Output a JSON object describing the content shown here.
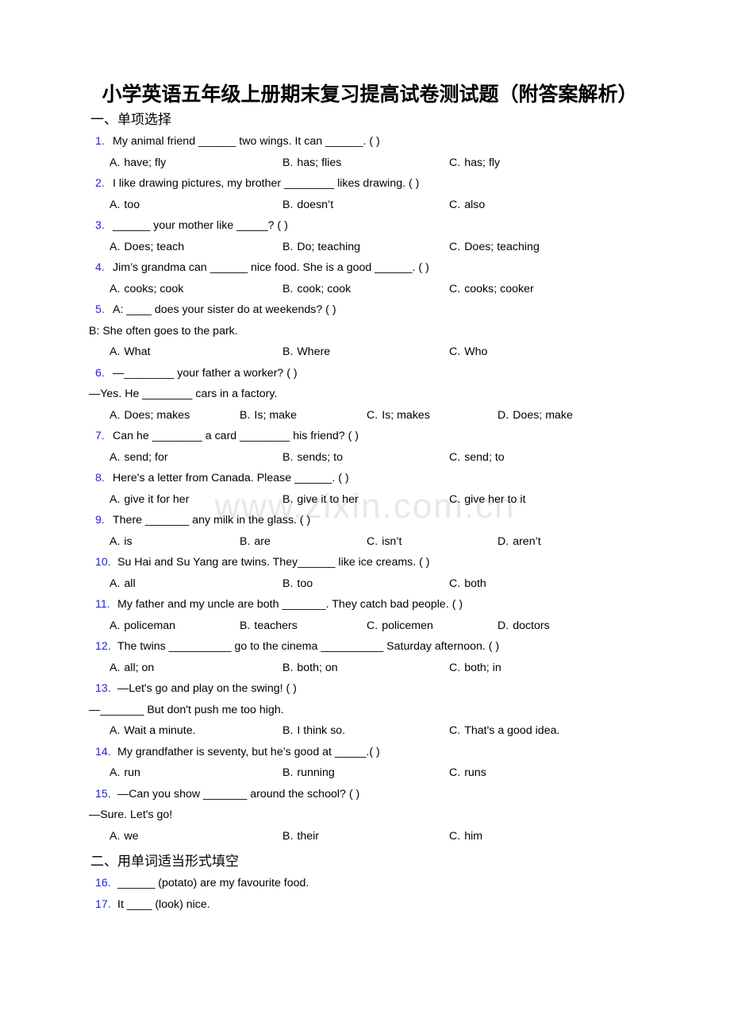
{
  "document": {
    "title": "小学英语五年级上册期末复习提高试卷测试题（附答案解析）",
    "watermark": "www.zixin.com.cn"
  },
  "sections": [
    {
      "heading": "一、单项选择",
      "questions": [
        {
          "num": "1.",
          "stem": "My animal friend ______ two wings. It can ______. (  )",
          "extra": null,
          "options": [
            {
              "label": "A.",
              "text": "have; fly"
            },
            {
              "label": "B.",
              "text": "has; flies"
            },
            {
              "label": "C.",
              "text": "has; fly"
            }
          ]
        },
        {
          "num": "2.",
          "stem": "I like drawing pictures, my brother ________ likes drawing. (    )",
          "extra": null,
          "options": [
            {
              "label": "A.",
              "text": "too"
            },
            {
              "label": "B.",
              "text": "doesn’t"
            },
            {
              "label": "C.",
              "text": "also"
            }
          ]
        },
        {
          "num": "3.",
          "stem": "______ your mother like _____? (  )",
          "extra": null,
          "options": [
            {
              "label": "A.",
              "text": "Does; teach"
            },
            {
              "label": "B.",
              "text": "Do; teaching"
            },
            {
              "label": "C.",
              "text": "Does; teaching"
            }
          ]
        },
        {
          "num": "4.",
          "stem": "Jim’s grandma can ______ nice food. She is a good ______. (  )",
          "extra": null,
          "options": [
            {
              "label": "A.",
              "text": "cooks; cook"
            },
            {
              "label": "B.",
              "text": "cook; cook"
            },
            {
              "label": "C.",
              "text": "cooks; cooker"
            }
          ]
        },
        {
          "num": "5.",
          "stem": "A: ____ does your sister do at weekends? (  )",
          "extra": "B: She often goes to the park.",
          "options": [
            {
              "label": "A.",
              "text": "What"
            },
            {
              "label": "B.",
              "text": "Where"
            },
            {
              "label": "C.",
              "text": "Who"
            }
          ]
        },
        {
          "num": "6.",
          "stem": "—________ your father a worker? (   )",
          "extra": "—Yes. He ________ cars in a factory.",
          "options": [
            {
              "label": "A.",
              "text": "Does; makes"
            },
            {
              "label": "B.",
              "text": "Is; make"
            },
            {
              "label": "C.",
              "text": "Is; makes"
            },
            {
              "label": "D.",
              "text": "Does; make"
            }
          ]
        },
        {
          "num": "7.",
          "stem": "Can he ________ a card ________ his friend? (   )",
          "extra": null,
          "options": [
            {
              "label": "A.",
              "text": "send; for"
            },
            {
              "label": "B.",
              "text": "sends; to"
            },
            {
              "label": "C.",
              "text": "send; to"
            }
          ]
        },
        {
          "num": "8.",
          "stem": "Here's a letter from Canada. Please ______. (  )",
          "extra": null,
          "options": [
            {
              "label": "A.",
              "text": "give it for her"
            },
            {
              "label": "B.",
              "text": "give it to her"
            },
            {
              "label": "C.",
              "text": "give her to it"
            }
          ]
        },
        {
          "num": "9.",
          "stem": "There _______ any milk in the glass. (  )",
          "extra": null,
          "options": [
            {
              "label": "A.",
              "text": "is"
            },
            {
              "label": "B.",
              "text": "are"
            },
            {
              "label": "C.",
              "text": "isn’t"
            },
            {
              "label": "D.",
              "text": "aren’t"
            }
          ]
        },
        {
          "num": "10.",
          "stem": "Su Hai and Su Yang are twins. They______ like ice creams. (  )",
          "extra": null,
          "options": [
            {
              "label": "A.",
              "text": "all"
            },
            {
              "label": "B.",
              "text": "too"
            },
            {
              "label": "C.",
              "text": "both"
            }
          ]
        },
        {
          "num": "11.",
          "stem": "My father and my uncle are both _______. They catch bad people. (  )",
          "extra": null,
          "options": [
            {
              "label": "A.",
              "text": "policeman"
            },
            {
              "label": "B.",
              "text": "teachers"
            },
            {
              "label": "C.",
              "text": "policemen"
            },
            {
              "label": "D.",
              "text": "doctors"
            }
          ]
        },
        {
          "num": "12.",
          "stem": "The twins __________ go to the cinema __________ Saturday afternoon. (   )",
          "extra": null,
          "options": [
            {
              "label": "A.",
              "text": "all; on"
            },
            {
              "label": "B.",
              "text": "both; on"
            },
            {
              "label": "C.",
              "text": "both; in"
            }
          ]
        },
        {
          "num": "13.",
          "stem": "—Let's go and play on the swing! (   )",
          "extra": "—_______ But don't push me too high.",
          "options": [
            {
              "label": "A.",
              "text": "Wait a minute."
            },
            {
              "label": "B.",
              "text": "I think so."
            },
            {
              "label": "C.",
              "text": "That's a good idea."
            }
          ]
        },
        {
          "num": "14.",
          "stem": "My grandfather is seventy, but he’s good at _____.(  )",
          "extra": null,
          "options": [
            {
              "label": "A.",
              "text": "run"
            },
            {
              "label": "B.",
              "text": "running"
            },
            {
              "label": "C.",
              "text": "runs"
            }
          ]
        },
        {
          "num": "15.",
          "stem": "—Can you show _______ around the school? (  )",
          "extra": "—Sure. Let's go!",
          "options": [
            {
              "label": "A.",
              "text": "we"
            },
            {
              "label": "B.",
              "text": "their"
            },
            {
              "label": "C.",
              "text": "him"
            }
          ]
        }
      ]
    },
    {
      "heading": "二、用单词适当形式填空",
      "questions": [
        {
          "num": "16.",
          "stem": "______ (potato) are my favourite food.",
          "extra": null,
          "options": []
        },
        {
          "num": "17.",
          "stem": "It ____ (look) nice.",
          "extra": null,
          "options": []
        }
      ]
    }
  ]
}
